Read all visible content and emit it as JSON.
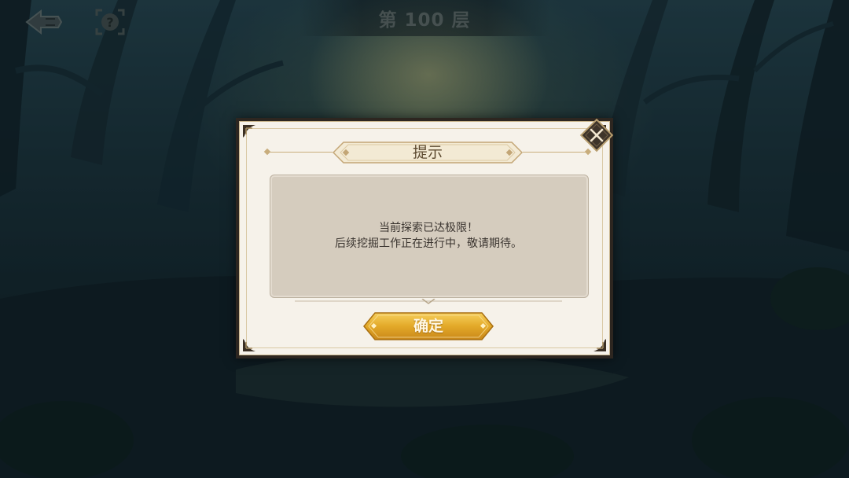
{
  "hud": {
    "floor_title": "第 100 层",
    "back_icon": "back-arrow-icon",
    "help_icon": "question-mark-icon"
  },
  "dialog": {
    "title": "提示",
    "message_line1": "当前探索已达极限！",
    "message_line2": "后续挖掘工作正在进行中，敬请期待。",
    "confirm_label": "确定",
    "close_icon": "close-icon"
  },
  "colors": {
    "dialog_bg": "#f6f2ea",
    "message_bg": "#d5ccbe",
    "button_gold": "#e0a82a",
    "title_text": "#5d4a30"
  }
}
